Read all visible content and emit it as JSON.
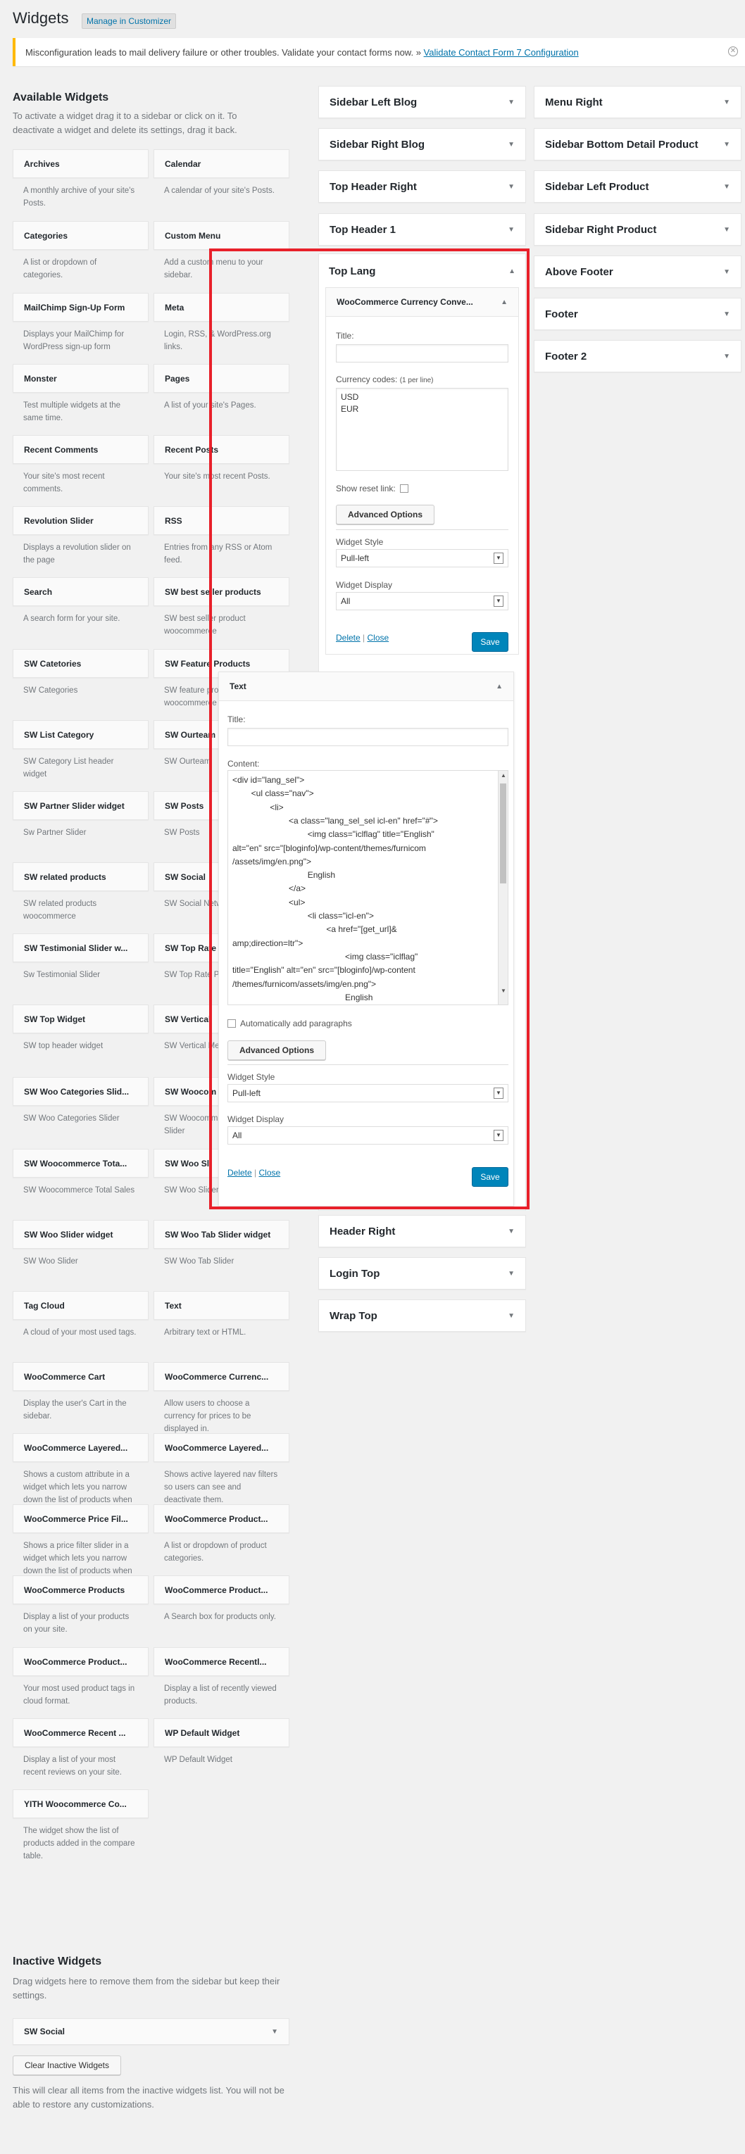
{
  "page": {
    "title": "Widgets",
    "manage_button": "Manage in Customizer"
  },
  "notice": {
    "text": "Misconfiguration leads to mail delivery failure or other troubles. Validate your contact forms now. »",
    "link": "Validate Contact Form 7 Configuration"
  },
  "available": {
    "title": "Available Widgets",
    "description": "To activate a widget drag it to a sidebar or click on it. To deactivate a widget and delete its settings, drag it back.",
    "widgets": [
      {
        "title": "Archives",
        "desc": "A monthly archive of your site's Posts."
      },
      {
        "title": "Calendar",
        "desc": "A calendar of your site's Posts."
      },
      {
        "title": "Categories",
        "desc": "A list or dropdown of categories."
      },
      {
        "title": "Custom Menu",
        "desc": "Add a custom menu to your sidebar."
      },
      {
        "title": "MailChimp Sign-Up Form",
        "desc": "Displays your MailChimp for WordPress sign-up form"
      },
      {
        "title": "Meta",
        "desc": "Login, RSS, & WordPress.org links."
      },
      {
        "title": "Monster",
        "desc": "Test multiple widgets at the same time."
      },
      {
        "title": "Pages",
        "desc": "A list of your site's Pages."
      },
      {
        "title": "Recent Comments",
        "desc": "Your site's most recent comments."
      },
      {
        "title": "Recent Posts",
        "desc": "Your site's most recent Posts."
      },
      {
        "title": "Revolution Slider",
        "desc": "Displays a revolution slider on the page"
      },
      {
        "title": "RSS",
        "desc": "Entries from any RSS or Atom feed."
      },
      {
        "title": "Search",
        "desc": "A search form for your site."
      },
      {
        "title": "SW best seller products",
        "desc": "SW best seller product woocommerce"
      },
      {
        "title": "SW Catetories",
        "desc": "SW Categories"
      },
      {
        "title": "SW Feature Products",
        "desc": "SW feature products woocommerce"
      },
      {
        "title": "SW List Category",
        "desc": "SW Category List header widget"
      },
      {
        "title": "SW Ourteam",
        "desc": "SW Ourteam"
      },
      {
        "title": "SW Partner Slider widget",
        "desc": "Sw Partner Slider"
      },
      {
        "title": "SW Posts",
        "desc": "SW Posts"
      },
      {
        "title": "SW related products",
        "desc": "SW related products woocommerce"
      },
      {
        "title": "SW Social",
        "desc": "SW Social Network"
      },
      {
        "title": "SW Testimonial Slider w...",
        "desc": "Sw Testimonial Slider"
      },
      {
        "title": "SW Top Rate",
        "desc": "SW Top Rate Product Widget"
      },
      {
        "title": "SW Top Widget",
        "desc": "SW top header widget"
      },
      {
        "title": "SW Vertical",
        "desc": "SW Vertical Menu Widget"
      },
      {
        "title": "SW Woo Categories Slid...",
        "desc": "SW Woo Categories Slider"
      },
      {
        "title": "SW Woocom",
        "desc": "SW Woocommerce Upsell Slider"
      },
      {
        "title": "SW Woocommerce Tota...",
        "desc": "SW Woocommerce Total Sales"
      },
      {
        "title": "SW Woo Sli",
        "desc": "SW Woo Slider"
      },
      {
        "title": "SW Woo Slider widget",
        "desc": "SW Woo Slider"
      },
      {
        "title": "SW Woo Tab Slider widget",
        "desc": "SW Woo Tab Slider"
      },
      {
        "title": "Tag Cloud",
        "desc": "A cloud of your most used tags."
      },
      {
        "title": "Text",
        "desc": "Arbitrary text or HTML."
      },
      {
        "title": "WooCommerce Cart",
        "desc": "Display the user's Cart in the sidebar."
      },
      {
        "title": "WooCommerce Currenc...",
        "desc": "Allow users to choose a currency for prices to be displayed in."
      },
      {
        "title": "WooCommerce Layered...",
        "desc": "Shows a custom attribute in a widget which lets you narrow down the list of products when viewing product categories."
      },
      {
        "title": "WooCommerce Layered...",
        "desc": "Shows active layered nav filters so users can see and deactivate them."
      },
      {
        "title": "WooCommerce Price Fil...",
        "desc": "Shows a price filter slider in a widget which lets you narrow down the list of products when viewing product categories."
      },
      {
        "title": "WooCommerce Product...",
        "desc": "A list or dropdown of product categories."
      },
      {
        "title": "WooCommerce Products",
        "desc": "Display a list of your products on your site."
      },
      {
        "title": "WooCommerce Product...",
        "desc": "A Search box for products only."
      },
      {
        "title": "WooCommerce Product...",
        "desc": "Your most used product tags in cloud format."
      },
      {
        "title": "WooCommerce Recentl...",
        "desc": "Display a list of recently viewed products."
      },
      {
        "title": "WooCommerce Recent ...",
        "desc": "Display a list of your most recent reviews on your site."
      },
      {
        "title": "WP Default Widget",
        "desc": "WP Default Widget"
      },
      {
        "title": "YITH Woocommerce Co...",
        "desc": "The widget show the list of products added in the compare table."
      }
    ]
  },
  "sidebars_mid": [
    {
      "name": "Sidebar Left Blog"
    },
    {
      "name": "Sidebar Right Blog"
    },
    {
      "name": "Top Header Right"
    },
    {
      "name": "Top Header 1"
    },
    {
      "name": "Top Lang"
    },
    {
      "name": "Header Right"
    },
    {
      "name": "Login Top"
    },
    {
      "name": "Wrap Top"
    }
  ],
  "sidebars_right": [
    {
      "name": "Menu Right"
    },
    {
      "name": "Sidebar Bottom Detail Product"
    },
    {
      "name": "Sidebar Left Product"
    },
    {
      "name": "Sidebar Right Product"
    },
    {
      "name": "Above Footer"
    },
    {
      "name": "Footer"
    },
    {
      "name": "Footer 2"
    }
  ],
  "currency_widget": {
    "title": "WooCommerce Currency Conve...",
    "title_label": "Title:",
    "codes_label": "Currency codes:",
    "codes_hint": "(1 per line)",
    "codes_value": "USD\nEUR",
    "reset_label": "Show reset link:",
    "advanced": "Advanced Options",
    "style_label": "Widget Style",
    "style_value": "Pull-left",
    "display_label": "Widget Display",
    "display_value": "All",
    "delete": "Delete",
    "close": "Close",
    "save": "Save"
  },
  "text_widget": {
    "title": "Text",
    "title_label": "Title:",
    "content_label": "Content:",
    "code_lines": [
      "<div id=\"lang_sel\">",
      "        <ul class=\"nav\">",
      "                <li>",
      "                        <a class=\"lang_sel_sel icl-en\" href=\"#\">",
      "                                <img class=\"iclflag\" title=\"English\"",
      "alt=\"en\" src=\"[bloginfo]/wp-content/themes/furnicom",
      "/assets/img/en.png\">",
      "                                English",
      "                        </a>",
      "                        <ul>",
      "                                <li class=\"icl-en\">",
      "                                        <a href=\"[get_url]&",
      "amp;direction=ltr\">",
      "                                                <img class=\"iclflag\"",
      "title=\"English\" alt=\"en\" src=\"[bloginfo]/wp-content",
      "/themes/furnicom/assets/img/en.png\">",
      "                                                English"
    ],
    "auto_p": "Automatically add paragraphs",
    "advanced": "Advanced Options",
    "style_label": "Widget Style",
    "style_value": "Pull-left",
    "display_label": "Widget Display",
    "display_value": "All",
    "delete": "Delete",
    "close": "Close",
    "save": "Save"
  },
  "inactive": {
    "title": "Inactive Widgets",
    "description": "Drag widgets here to remove them from the sidebar but keep their settings.",
    "widget": "SW Social",
    "clear_button": "Clear Inactive Widgets",
    "note": "This will clear all items from the inactive widgets list. You will not be able to restore any customizations."
  },
  "colors": {
    "highlight": "#e8202a",
    "accent": "#0073aa",
    "save": "#0085ba",
    "notice": "#ffb900"
  }
}
